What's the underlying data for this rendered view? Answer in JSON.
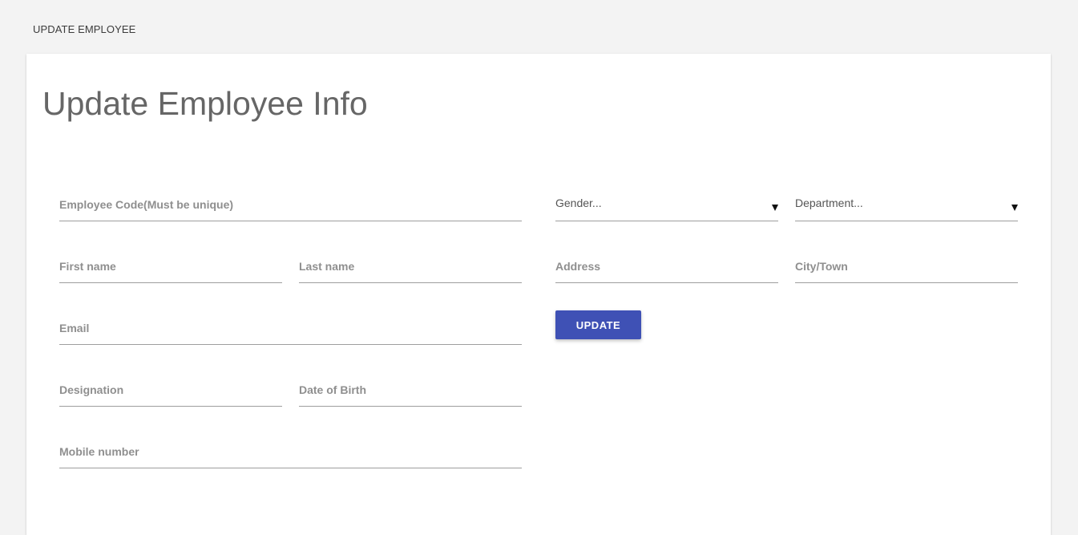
{
  "header": {
    "title": "UPDATE EMPLOYEE"
  },
  "form": {
    "title": "Update Employee Info",
    "fields": {
      "employee_code": {
        "placeholder": "Employee Code(Must be unique)",
        "value": ""
      },
      "first_name": {
        "placeholder": "First name",
        "value": ""
      },
      "last_name": {
        "placeholder": "Last name",
        "value": ""
      },
      "email": {
        "placeholder": "Email",
        "value": ""
      },
      "designation": {
        "placeholder": "Designation",
        "value": ""
      },
      "date_of_birth": {
        "placeholder": "Date of Birth",
        "value": ""
      },
      "mobile_number": {
        "placeholder": "Mobile number",
        "value": ""
      },
      "address": {
        "placeholder": "Address",
        "value": ""
      },
      "city_town": {
        "placeholder": "City/Town",
        "value": ""
      }
    },
    "selects": {
      "gender": {
        "selected": "Gender..."
      },
      "department": {
        "selected": "Department..."
      }
    },
    "update_label": "UPDATE"
  },
  "colors": {
    "page_background": "#f3f3f3",
    "card_background": "#ffffff",
    "button_primary": "#3f51b5",
    "title_text": "#666666"
  }
}
